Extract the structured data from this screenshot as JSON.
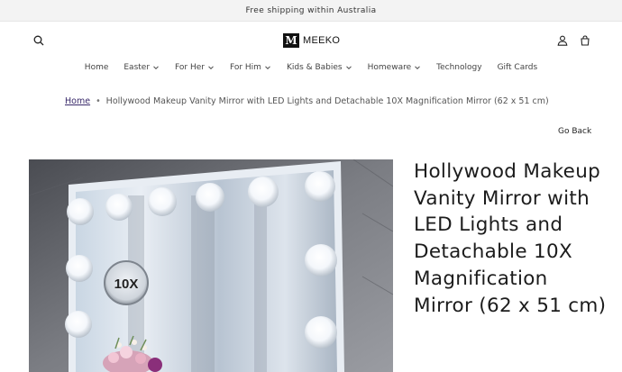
{
  "announcement": {
    "text": "Free shipping within Australia"
  },
  "header": {
    "logo_mark": "M",
    "logo_text": "MEEKO",
    "icons": {
      "search": "search-icon",
      "account": "user-icon",
      "cart": "cart-icon"
    }
  },
  "nav": {
    "items": [
      {
        "label": "Home",
        "has_dropdown": false
      },
      {
        "label": "Easter",
        "has_dropdown": true
      },
      {
        "label": "For Her",
        "has_dropdown": true
      },
      {
        "label": "For Him",
        "has_dropdown": true
      },
      {
        "label": "Kids & Babies",
        "has_dropdown": true
      },
      {
        "label": "Homeware",
        "has_dropdown": true
      },
      {
        "label": "Technology",
        "has_dropdown": false
      },
      {
        "label": "Gift Cards",
        "has_dropdown": false
      }
    ]
  },
  "breadcrumb": {
    "home": "Home",
    "separator": "•",
    "current": "Hollywood Makeup Vanity Mirror with LED Lights and Detachable 10X Magnification Mirror (62 x 51 cm)"
  },
  "go_back": "Go Back",
  "product": {
    "title": "Hollywood Makeup Vanity Mirror with LED Lights and Detachable 10X Magnification Mirror (62 x 51 cm)",
    "image_badge": "10X"
  },
  "colors": {
    "breadcrumb_link": "#3a2a6a",
    "announcement_bg": "#f3f3f3"
  }
}
